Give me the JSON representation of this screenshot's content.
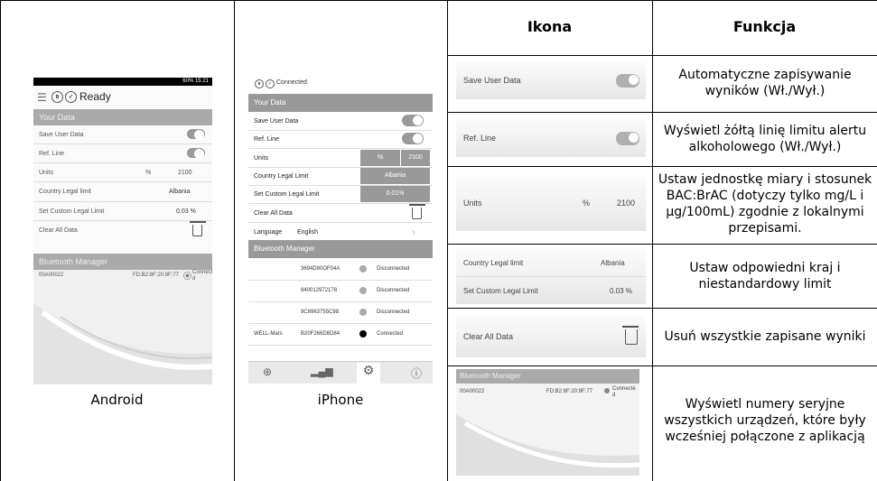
{
  "header": {
    "icon": "Ikona",
    "function": "Funkcja"
  },
  "android": {
    "caption": "Android",
    "status_bar": "60% 15:21",
    "title": "Ready",
    "section_your_data": "Your Data",
    "rows": {
      "save_user_data": "Save User Data",
      "ref_line": "Ref. Line",
      "units": "Units",
      "units_pct": "%",
      "units_ratio": "2100",
      "country": "Country Legal limit",
      "country_value": "Albania",
      "custom": "Set Custom Legal Limit",
      "custom_value": "0.03 %",
      "clear": "Clear All Data"
    },
    "bluetooth": "Bluetooth Manager",
    "device_id": "00A00022",
    "device_mac": "FD:B2:8F:20:9F:77",
    "device_status": "Connecte d"
  },
  "iphone": {
    "caption": "iPhone",
    "status": "Connected",
    "section_your_data": "Your Data",
    "rows": {
      "save_user_data": "Save User Data",
      "ref_line": "Ref. Line",
      "units": "Units",
      "units_pct": "%",
      "units_ratio": "2100",
      "country": "Country Legal Limit",
      "country_value": "Albania",
      "custom": "Set Custom Legal Limit",
      "custom_value": "0.01%",
      "clear": "Clear All Data",
      "language": "Language",
      "language_value": "English"
    },
    "bluetooth": "Bluetooth Manager",
    "devices": [
      {
        "name": "",
        "id": "3694D90OF04A",
        "status": "Disconnected"
      },
      {
        "name": "",
        "id": "840012972178",
        "status": "Disconnected"
      },
      {
        "name": "",
        "id": "9C8963755C98",
        "status": "Disconnected"
      },
      {
        "name": "WELL-Mars",
        "id": "B20F266D8D84",
        "status": "Connected"
      }
    ]
  },
  "functions": [
    {
      "ui": [
        "Save User Data"
      ],
      "desc": "Automatyczne zapisywanie wyników (Wł./Wył.)"
    },
    {
      "ui": [
        "Ref. Line"
      ],
      "desc": "Wyświetl żółtą linię limitu alertu alkoholowego (Wł./Wył.)"
    },
    {
      "ui": [
        "Units",
        "%",
        "2100"
      ],
      "desc": "Ustaw jednostkę miary i stosunek BAC:BrAC (dotyczy tylko mg/L i µg/100mL) zgodnie z lokalnymi przepisami."
    },
    {
      "ui": [
        "Country Legal limit",
        "Albania",
        "Set Custom Legal Limit",
        "0.03 %"
      ],
      "desc": "Ustaw odpowiedni kraj i niestandardowy limit"
    },
    {
      "ui": [
        "Clear All Data"
      ],
      "desc": "Usuń wszystkie zapisane wyniki"
    },
    {
      "ui": [
        "Bluetooth Manager",
        "00A00022",
        "FD:B2:8F:20:9F:77",
        "Connecte d"
      ],
      "desc": "Wyświetl numery seryjne wszystkich urządzeń, które były wcześniej połączone z aplikacją"
    }
  ]
}
